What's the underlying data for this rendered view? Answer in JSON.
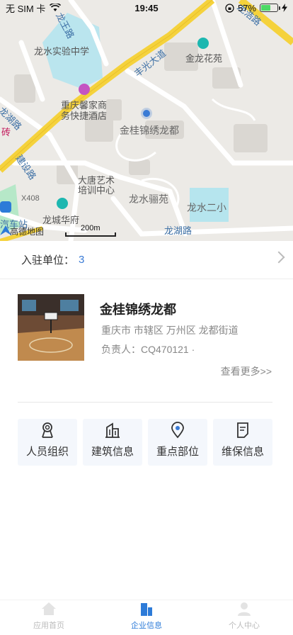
{
  "status": {
    "carrier": "无 SIM 卡",
    "time": "19:45",
    "battery": "57%",
    "battery_level": 0.57
  },
  "map": {
    "labels": {
      "longwang_road": "龙王路",
      "longshui_school": "龙水实验中学",
      "fengguang_ave": "丰光大道",
      "jinlong_garden": "金龙花苑",
      "longhu_road_left": "龙湖路",
      "hotel_line1": "重庆馨家商",
      "hotel_line2": "务快捷酒店",
      "zhuan": "砖",
      "jingui": "金桂锦绣龙都",
      "jianshe_road": "建设路",
      "datang_line1": "大唐艺术",
      "datang_line2": "培训中心",
      "x408": "X408",
      "longshui_lijing": "龙水骊苑",
      "longshui_2": "龙水二小",
      "longcheng": "龙城华府",
      "bus_station": "汽车站",
      "longhu_road_bottom": "龙湖路",
      "road_corner": "龙浩路",
      "gaode": "高德地图",
      "scale": "200m"
    }
  },
  "info": {
    "label": "入驻单位：",
    "count": "3"
  },
  "card": {
    "title": "金桂锦绣龙都",
    "address": "重庆市 市辖区 万州区 龙都街道",
    "owner": "负责人：CQ470121 ·"
  },
  "more": "查看更多>>",
  "grid": [
    {
      "label": "人员组织",
      "icon": "person-badge-icon"
    },
    {
      "label": "建筑信息",
      "icon": "building-icon"
    },
    {
      "label": "重点部位",
      "icon": "location-pin-icon"
    },
    {
      "label": "维保信息",
      "icon": "document-icon"
    }
  ],
  "tabs": [
    {
      "label": "应用首页",
      "icon": "home-icon"
    },
    {
      "label": "企业信息",
      "icon": "buildings-icon"
    },
    {
      "label": "个人中心",
      "icon": "user-icon"
    }
  ],
  "colors": {
    "accent": "#2d7bd8",
    "road_yellow": "#f5d23c",
    "water": "#a9e3f0"
  }
}
